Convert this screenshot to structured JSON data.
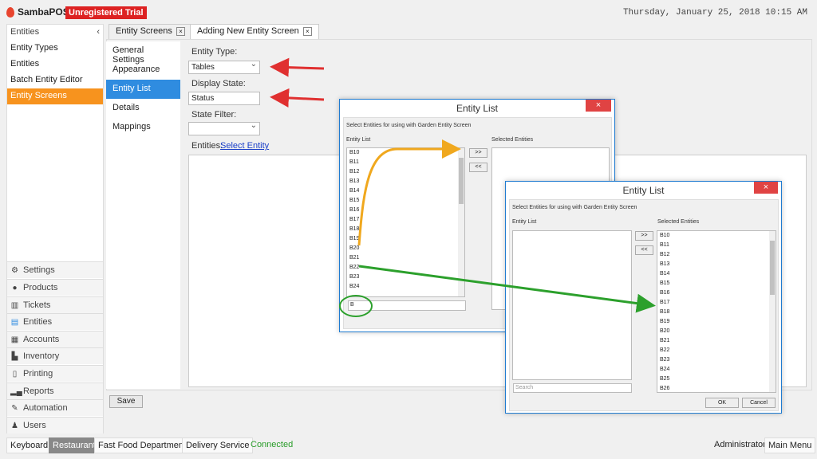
{
  "app": {
    "name": "SambaPOS",
    "trial_badge": "Unregistered Trial",
    "datetime": "Thursday, January 25, 2018 10:15 AM"
  },
  "sidebar": {
    "header": "Entities",
    "collapse": "‹",
    "items": [
      {
        "label": "Entity Types"
      },
      {
        "label": "Entities"
      },
      {
        "label": "Batch Entity Editor"
      },
      {
        "label": "Entity Screens",
        "active": true
      }
    ],
    "nav": [
      {
        "label": "Settings",
        "icon": "gear-icon"
      },
      {
        "label": "Products",
        "icon": "products-icon"
      },
      {
        "label": "Tickets",
        "icon": "tickets-icon"
      },
      {
        "label": "Entities",
        "icon": "entities-icon"
      },
      {
        "label": "Accounts",
        "icon": "accounts-icon"
      },
      {
        "label": "Inventory",
        "icon": "inventory-icon"
      },
      {
        "label": "Printing",
        "icon": "printing-icon"
      },
      {
        "label": "Reports",
        "icon": "reports-icon"
      },
      {
        "label": "Automation",
        "icon": "automation-icon"
      },
      {
        "label": "Users",
        "icon": "users-icon"
      }
    ]
  },
  "tabs": [
    {
      "label": "Entity Screens",
      "close": "×"
    },
    {
      "label": "Adding New Entity Screen",
      "close": "×",
      "active": true
    }
  ],
  "subnav": [
    {
      "label": "General Settings"
    },
    {
      "label": "Appearance"
    },
    {
      "label": "Entity List",
      "active": true
    },
    {
      "label": "Details"
    },
    {
      "label": "Mappings"
    }
  ],
  "form": {
    "entity_type_label": "Entity Type:",
    "entity_type_value": "Tables",
    "display_state_label": "Display State:",
    "display_state_value": "Status",
    "state_filter_label": "State Filter:",
    "state_filter_value": "",
    "entities_label": "Entities:",
    "select_entity_link": "Select Entity"
  },
  "save_label": "Save",
  "dialog1": {
    "title": "Entity List",
    "close": "×",
    "instructions": "Select Entities for using with Garden Entity Screen",
    "left_label": "Entity List",
    "right_label": "Selected Entities",
    "add_btn": ">>",
    "remove_btn": "<<",
    "items": [
      "B10",
      "B11",
      "B12",
      "B13",
      "B14",
      "B15",
      "B16",
      "B17",
      "B18",
      "B19",
      "B20",
      "B21",
      "B22",
      "B23",
      "B24"
    ],
    "search_value": "B"
  },
  "dialog2": {
    "title": "Entity List",
    "close": "×",
    "instructions": "Select Entities for using with Garden Entity Screen",
    "left_label": "Entity List",
    "right_label": "Selected Entities",
    "add_btn": ">>",
    "remove_btn": "<<",
    "selected": [
      "B10",
      "B11",
      "B12",
      "B13",
      "B14",
      "B15",
      "B16",
      "B17",
      "B18",
      "B19",
      "B20",
      "B21",
      "B22",
      "B23",
      "B24",
      "B25",
      "B26"
    ],
    "search_placeholder": "Search",
    "ok": "OK",
    "cancel": "Cancel"
  },
  "statusbar": {
    "left": [
      {
        "label": "Keyboard"
      },
      {
        "label": "Restaurant",
        "active": true
      },
      {
        "label": "Fast Food Department"
      },
      {
        "label": "Delivery Service"
      }
    ],
    "connected": "Connected",
    "user": "Administrator",
    "main_menu": "Main Menu"
  },
  "colors": {
    "accent_orange": "#f7931e",
    "accent_blue": "#2f8ce0",
    "connected": "#2a9d2a",
    "arrow_red": "#e03030",
    "arrow_orange": "#f0a81e",
    "arrow_green": "#2ca02c"
  }
}
